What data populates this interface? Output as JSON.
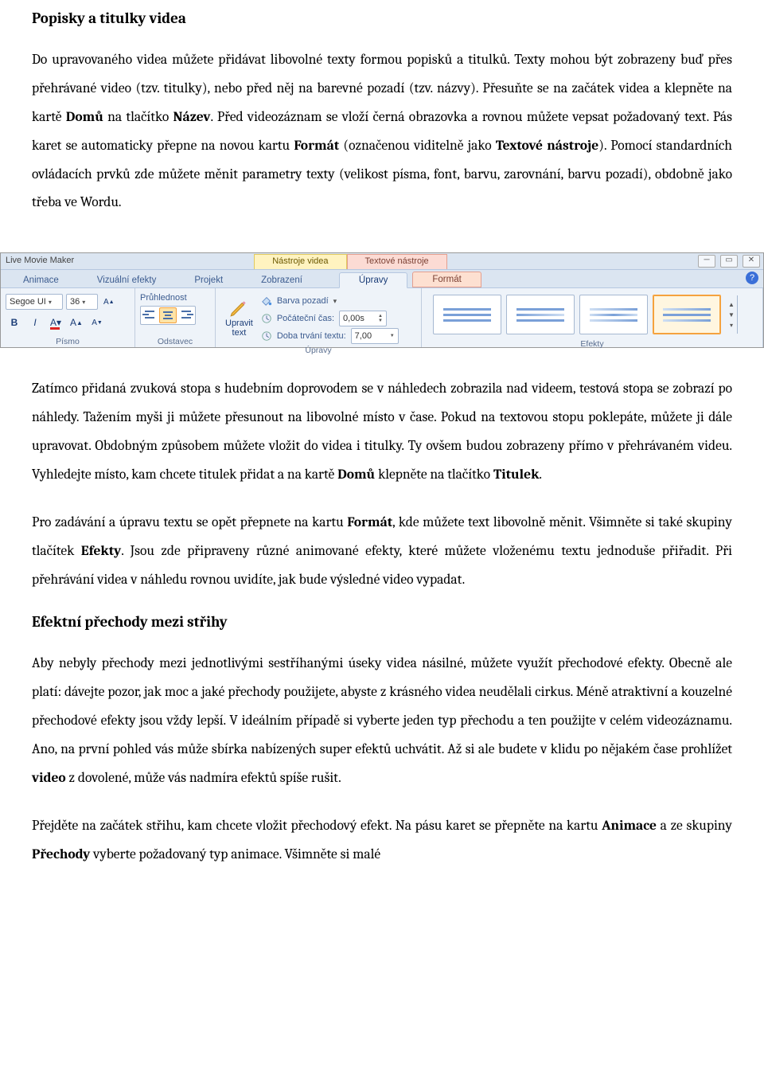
{
  "headings": {
    "h1": "Popisky a titulky videa",
    "h2": "Efektní přechody mezi střihy"
  },
  "paragraphs": {
    "p1_pre": "Do upravovaného videa můžete přidávat libovolné texty formou popisků a titulků. Texty mohou být zobrazeny buď přes přehrávané video (tzv. titulky), nebo před něj na barevné pozadí (tzv. názvy). Přesuňte se na začátek videa a klepněte na kartě ",
    "p1_b1": "Domů",
    "p1_mid1": " na tlačítko ",
    "p1_b2": "Název",
    "p1_mid2": ". Před videozáznam se vloží černá obrazovka a rovnou můžete vepsat požadovaný text. Pás karet se automaticky přepne na novou kartu ",
    "p1_b3": "Formát",
    "p1_mid3": " (označenou viditelně jako ",
    "p1_b4": "Textové nástroje",
    "p1_post": "). Pomocí standardních ovládacích prvků zde můžete měnit parametry texty (velikost písma, font, barvu, zarovnání, barvu pozadí), obdobně jako třeba ve Wordu.",
    "p2_pre": "Zatímco přidaná zvuková stopa s hudebním doprovodem se v náhledech zobrazila nad videem, testová stopa se zobrazí po náhledy. Tažením myši ji můžete přesunout na libovolné místo v čase. Pokud na textovou stopu poklepáte, můžete ji dále upravovat. Obdobným způsobem můžete vložit do videa i titulky. Ty ovšem budou zobrazeny přímo v přehrávaném videu. Vyhledejte místo, kam chcete titulek přidat a na kartě ",
    "p2_b1": "Domů",
    "p2_mid": " klepněte na tlačítko ",
    "p2_b2": "Titulek",
    "p2_post": ".",
    "p3_pre": "Pro zadávání a úpravu textu se opět přepnete na kartu ",
    "p3_b1": "Formát",
    "p3_mid1": ", kde můžete text libovolně měnit. Všimněte si také skupiny tlačítek ",
    "p3_b2": "Efekty",
    "p3_post": ". Jsou zde připraveny různé animované efekty, které můžete vloženému textu jednoduše přiřadit. Při přehrávání videa v náhledu rovnou uvidíte, jak bude výsledné video vypadat.",
    "p4_pre": "Aby nebyly přechody mezi jednotlivými sestříhanými úseky videa násilné, můžete využít přechodové efekty. Obecně ale platí: dávejte pozor, jak moc a jaké přechody použijete, abyste z krásného videa neudělali cirkus. Méně atraktivní a kouzelné přechodové efekty jsou vždy lepší. V ideálním případě si vyberte jeden typ přechodu a ten použijte v celém videozáznamu. Ano, na první pohled vás může sbírka nabízených super efektů uchvátit. Až si ale budete v klidu po nějakém čase prohlížet ",
    "p4_b1": "video",
    "p4_post": " z dovolené, může vás nadmíra efektů spíše rušit.",
    "p5_pre": "Přejděte na začátek střihu, kam chcete vložit přechodový efekt. Na pásu karet se přepněte na kartu ",
    "p5_b1": "Animace",
    "p5_mid": " a ze skupiny ",
    "p5_b2": "Přechody",
    "p5_post": " vyberte požadovaný typ animace. Všimněte si malé"
  },
  "ribbon": {
    "app_title": "Live Movie Maker",
    "context_tab1": "Nástroje videa",
    "context_tab2": "Textové nástroje",
    "tabs": {
      "t1": "Animace",
      "t2": "Vizuální efekty",
      "t3": "Projekt",
      "t4": "Zobrazení",
      "t5": "Úpravy",
      "t6": "Formát"
    },
    "font": {
      "name": "Segoe UI",
      "size": "36",
      "transparency": "Průhlednost",
      "bold": "B",
      "italic": "I"
    },
    "paragraph": {
      "group_label": "Odstavec"
    },
    "pismo_label": "Písmo",
    "edits": {
      "edit_text": "Upravit\ntext",
      "dropdown_arrow": "▾",
      "bg_color": "Barva pozadí",
      "start_time_label": "Počáteční čas:",
      "start_time_val": "0,00s",
      "duration_label": "Doba trvání textu:",
      "duration_val": "7,00",
      "group_label": "Úpravy"
    },
    "effects_label": "Efekty"
  }
}
